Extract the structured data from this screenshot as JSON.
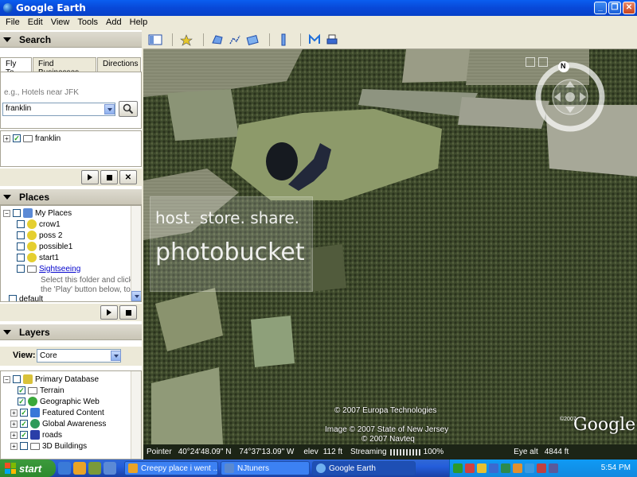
{
  "window": {
    "title": "Google Earth"
  },
  "menu": [
    "File",
    "Edit",
    "View",
    "Tools",
    "Add",
    "Help"
  ],
  "search": {
    "heading": "Search",
    "tabs": [
      "Fly To",
      "Find Businesses",
      "Directions"
    ],
    "hint": "e.g., Hotels near JFK",
    "value": "franklin",
    "result": "franklin"
  },
  "places": {
    "heading": "Places",
    "items": [
      {
        "label": "My Places",
        "checked": false
      },
      {
        "label": "crow1",
        "checked": false
      },
      {
        "label": "poss 2",
        "checked": false
      },
      {
        "label": "possible1",
        "checked": false
      },
      {
        "label": "start1",
        "checked": false
      },
      {
        "label": "Sightseeing",
        "checked": false
      },
      {
        "label": "default",
        "checked": false
      }
    ],
    "note_line1": "Select this folder and click on",
    "note_line2": "the 'Play' button below, to sta"
  },
  "layers": {
    "heading": "Layers",
    "view_label": "View:",
    "view_value": "Core",
    "items": [
      {
        "label": "Primary Database",
        "color": "#d9c23a"
      },
      {
        "label": "Terrain",
        "color": "#8a8a8a"
      },
      {
        "label": "Geographic Web",
        "color": "#3aa83a"
      },
      {
        "label": "Featured Content",
        "color": "#3a78d8"
      },
      {
        "label": "Global Awareness",
        "color": "#2e9a5a"
      },
      {
        "label": "roads",
        "color": "#2a3ea8"
      },
      {
        "label": "3D Buildings",
        "color": "#8a8a8a"
      }
    ]
  },
  "map": {
    "credits": [
      "© 2007 Europa Technologies",
      "Image © 2007 State of New Jersey",
      "© 2007 Navteq"
    ],
    "logo": "Google",
    "logo_year": "©2007",
    "nav_label": "N",
    "watermark": "host. store. share.",
    "watermark2": "photobucket"
  },
  "status": {
    "pointer_label": "Pointer",
    "lat": "40°24'48.09\"  N",
    "lon": "74°37'13.09\"  W",
    "elev_label": "elev",
    "elev_value": "112 ft",
    "streaming_label": "Streaming",
    "streaming_pct": "100%",
    "eye_label": "Eye alt",
    "eye_value": "4844 ft"
  },
  "taskbar": {
    "start": "start",
    "tasks": [
      "Creepy place i went ...",
      "NJtuners",
      "Google Earth"
    ],
    "clock": "5:54 PM"
  }
}
